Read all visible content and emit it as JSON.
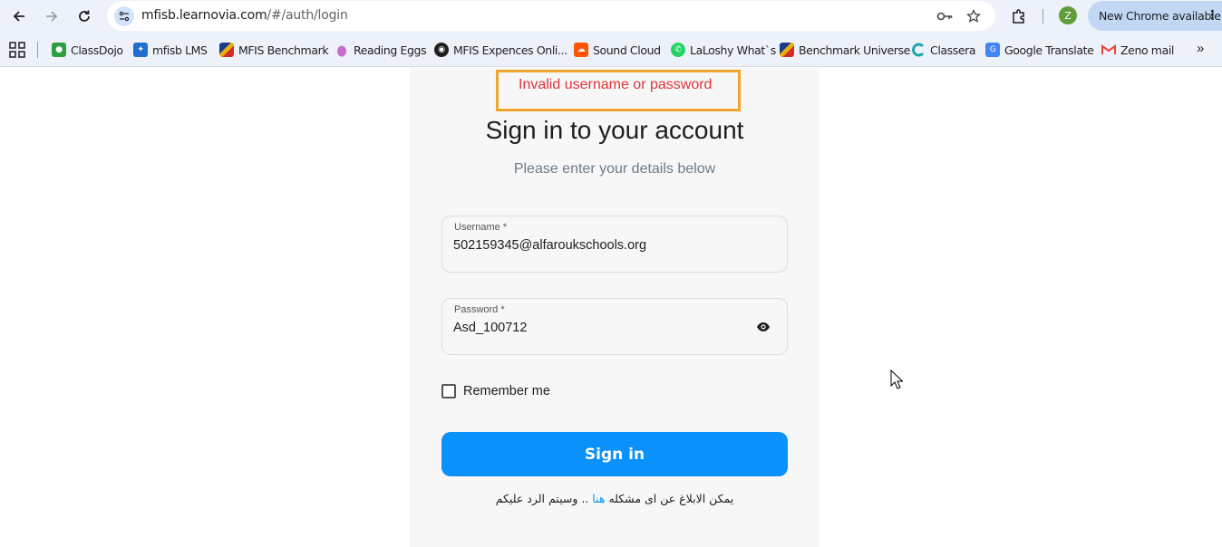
{
  "browser": {
    "url_host": "mfisb.learnovia.com",
    "url_path": "/#/auth/login",
    "avatar_letter": "Z",
    "update_label": "New Chrome available"
  },
  "bookmarks": [
    {
      "label": "ClassDojo",
      "icon": "classdojo-icon",
      "color": "#2f9e44"
    },
    {
      "label": "mfisb LMS",
      "icon": "mfisb-lms-icon",
      "color": "#1f6fd1"
    },
    {
      "label": "MFIS Benchmark",
      "icon": "mfis-benchmark-icon",
      "color": "#1b3a8c"
    },
    {
      "label": "Reading Eggs",
      "icon": "reading-eggs-icon",
      "color": "#c86cc9"
    },
    {
      "label": "MFIS Expences Onli...",
      "icon": "github-icon",
      "color": "#1f1f1f"
    },
    {
      "label": "Sound Cloud",
      "icon": "soundcloud-icon",
      "color": "#ff5500"
    },
    {
      "label": "LaLoshy What`s",
      "icon": "whatsapp-icon",
      "color": "#25d366"
    },
    {
      "label": "Benchmark Universe",
      "icon": "benchmark-universe-icon",
      "color": "#1b3a8c"
    },
    {
      "label": "Classera",
      "icon": "classera-icon",
      "color": "#1fa7b5"
    },
    {
      "label": "Google Translate",
      "icon": "google-translate-icon",
      "color": "#4285f4"
    },
    {
      "label": "Zeno mail",
      "icon": "gmail-icon",
      "color": "#ea4335"
    }
  ],
  "login": {
    "error": "Invalid username or password",
    "title": "Sign in to your account",
    "subtitle": "Please enter your details below",
    "username_label": "Username *",
    "username_value": "502159345@alfaroukschools.org",
    "password_label": "Password *",
    "password_value": "Asd_100712",
    "remember_label": "Remember me",
    "signin_label": "Sign in",
    "report_prefix": "يمكن الابلاغ عن اى مشكله",
    "report_link": "هنا",
    "report_suffix": ".. وسيتم الرد عليكم"
  },
  "colors": {
    "accent": "#0a91fa",
    "error": "#e0343a",
    "highlight_border": "#f0a52c"
  }
}
